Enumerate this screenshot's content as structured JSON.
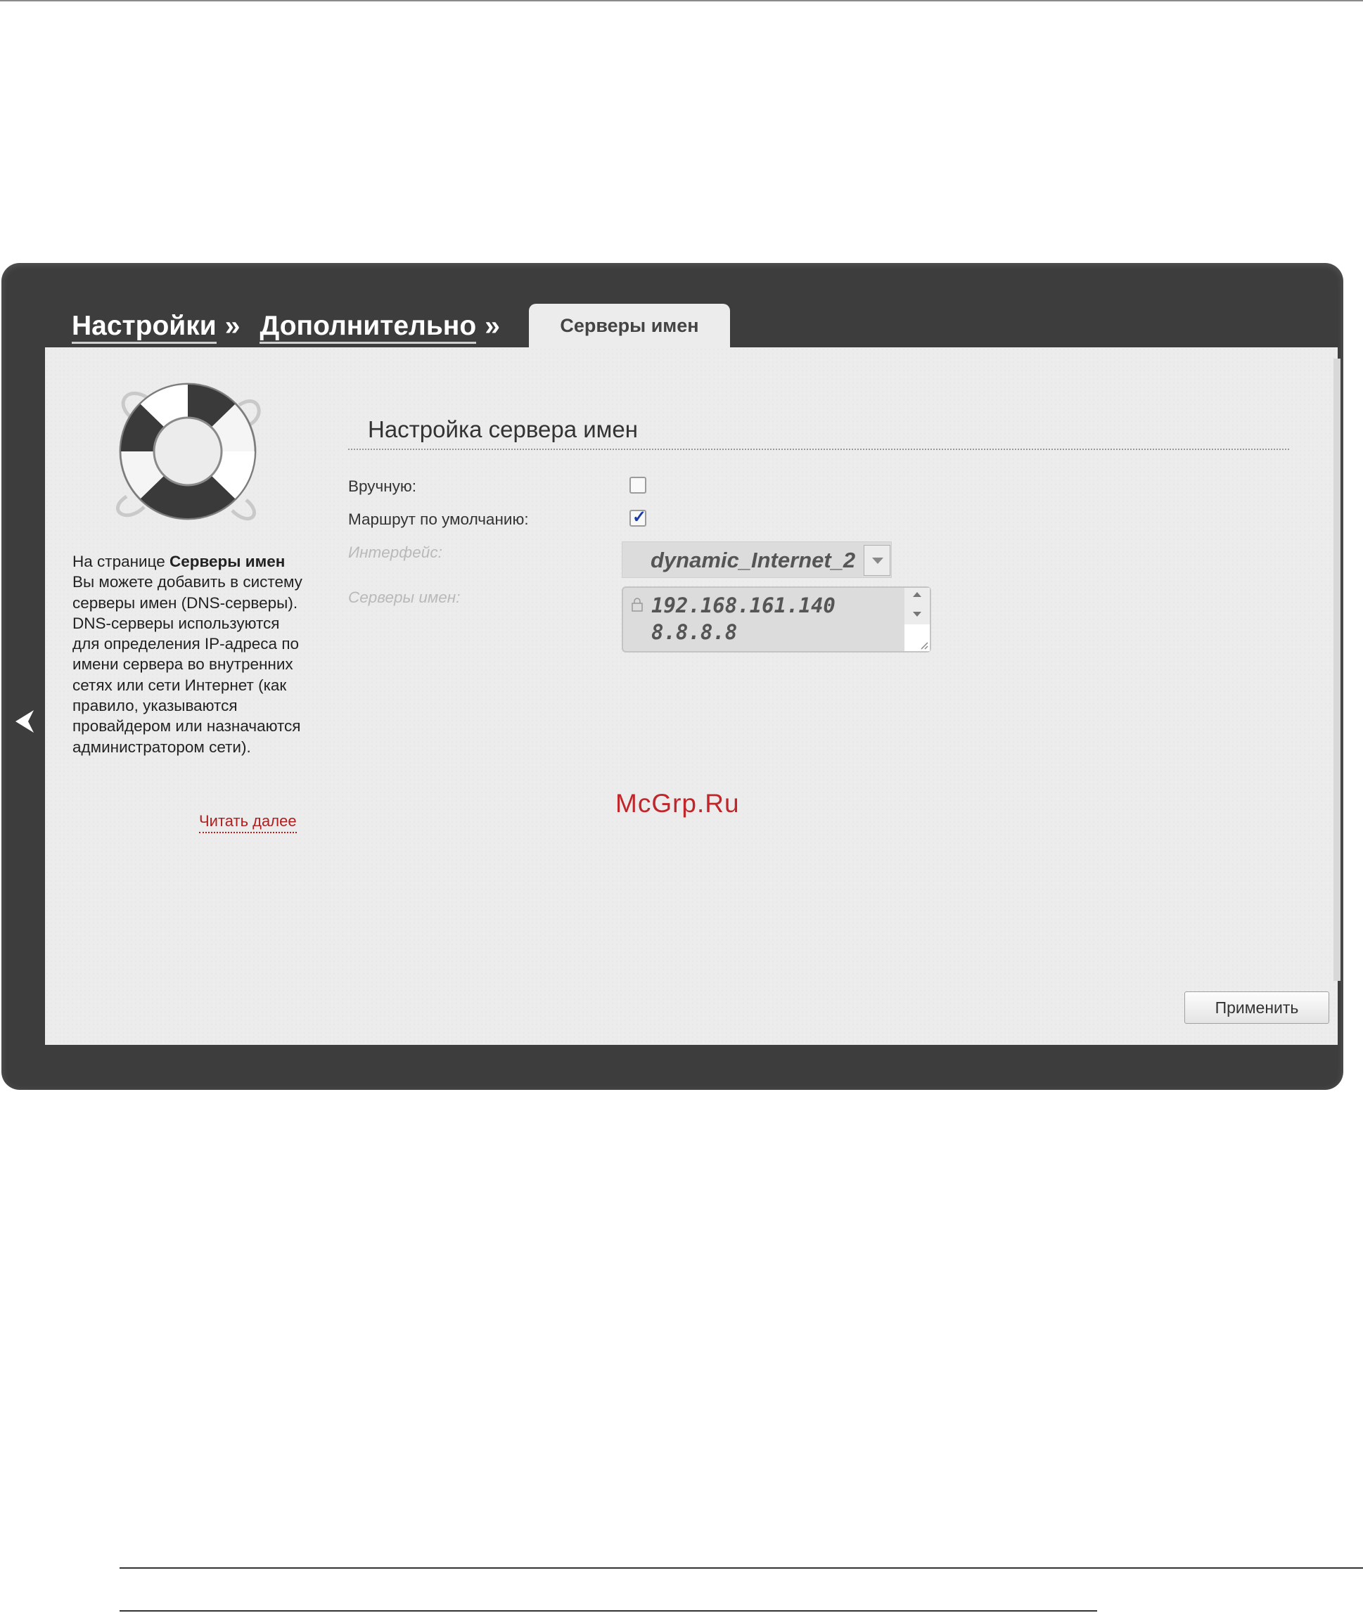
{
  "breadcrumb": {
    "items": [
      "Настройки",
      "Дополнительно"
    ],
    "separator": "»",
    "active_tab": "Серверы имен"
  },
  "help": {
    "intro": "На странице ",
    "page_name": "Серверы имен",
    "text_1": "Вы можете добавить в систему серверы имен (DNS-серверы).",
    "text_2": "DNS-серверы используются для определения IP-адреса по имени сервера во внутренних сетях или сети Интернет (как правило, указываются провайдером или назначаются администратором сети).",
    "read_more": "Читать далее"
  },
  "form": {
    "section_title": "Настройка сервера имен",
    "manual_label": "Вручную:",
    "manual_checked": false,
    "default_route_label": "Маршрут по умолчанию:",
    "default_route_checked": true,
    "interface_label": "Интерфейс:",
    "interface_value": "dynamic_Internet_2",
    "dns_label": "Серверы имен:",
    "dns_servers": [
      "192.168.161.140",
      "8.8.8.8"
    ],
    "apply_label": "Применить"
  },
  "watermark": "McGrp.Ru",
  "colors": {
    "frame": "#3d3d3d",
    "panel": "#ececec",
    "link": "#b01f1f",
    "watermark": "#c0262a",
    "check": "#1a3aa6"
  }
}
